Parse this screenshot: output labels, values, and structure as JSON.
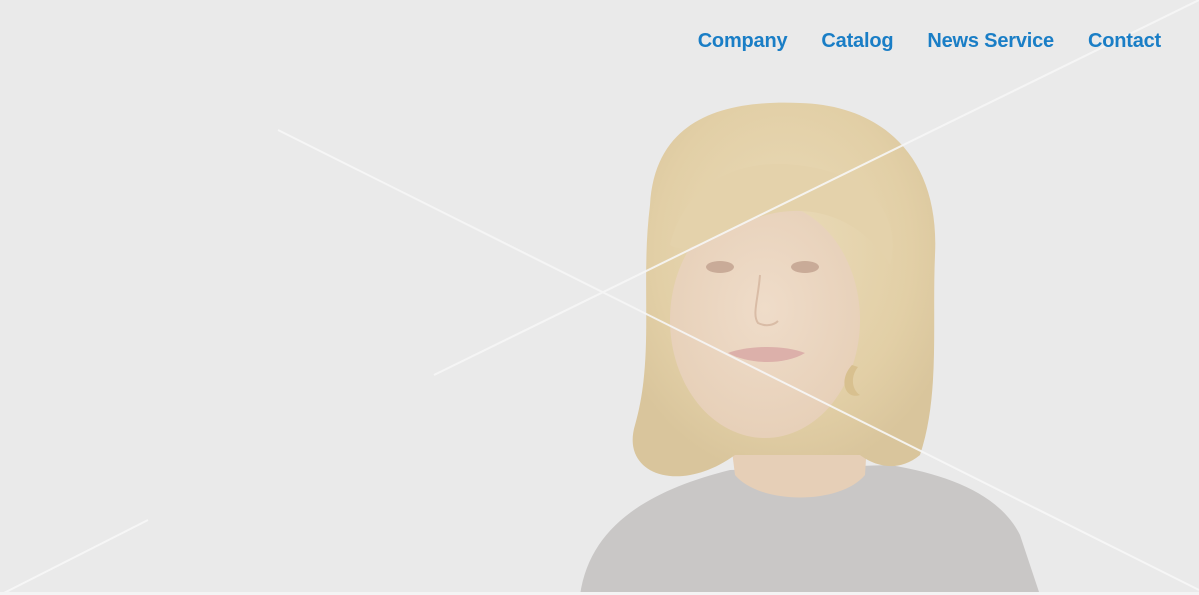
{
  "nav": {
    "items": [
      {
        "label": "Company"
      },
      {
        "label": "Catalog"
      },
      {
        "label": "News Service"
      },
      {
        "label": "Contact"
      }
    ]
  },
  "colors": {
    "background": "#eaeaea",
    "nav_link": "#1a7ec6"
  },
  "hero": {
    "image": "portrait-photo"
  }
}
